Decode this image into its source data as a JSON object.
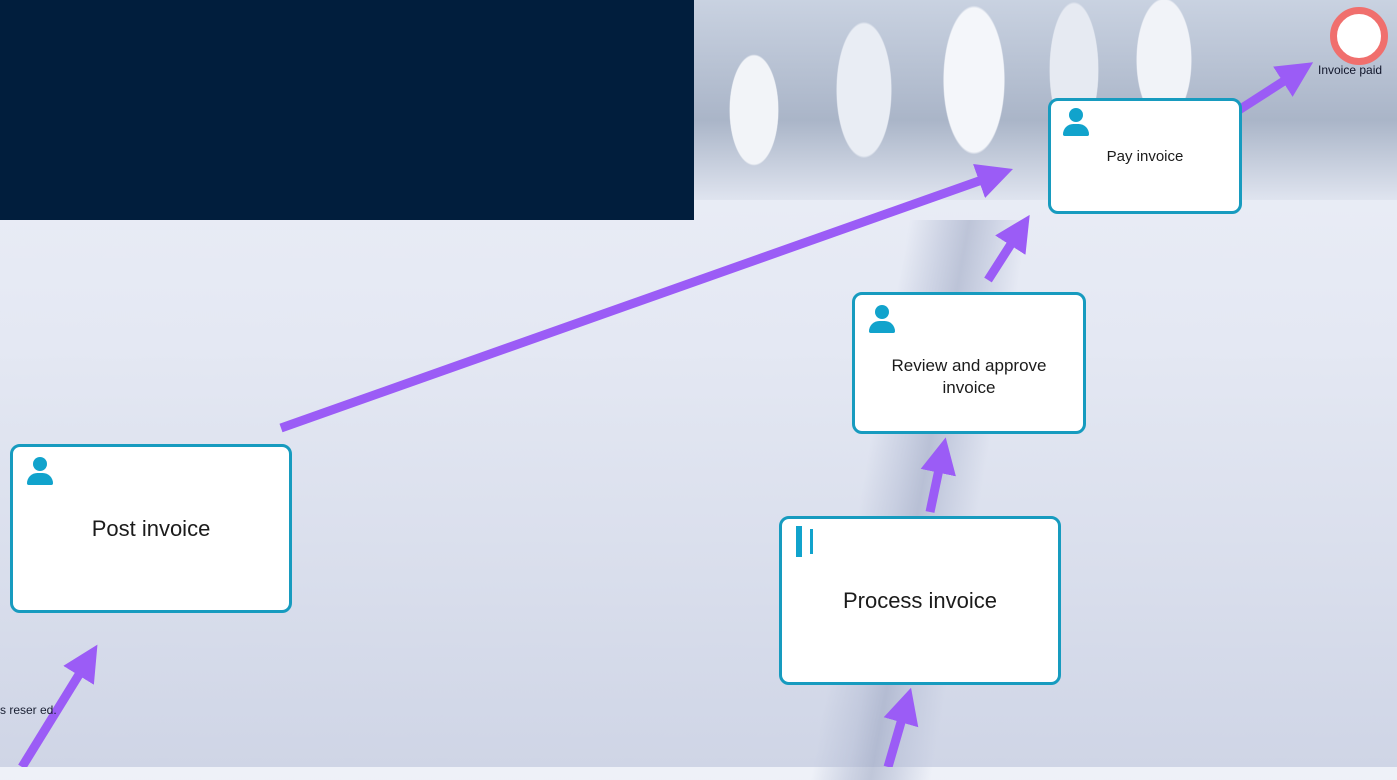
{
  "tasks": {
    "post": "Post invoice",
    "process": "Process invoice",
    "review": "Review and approve invoice",
    "pay": "Pay invoice"
  },
  "end_event": {
    "label": "Invoice paid"
  },
  "footer": {
    "text": "s reser  ed."
  },
  "colors": {
    "task_border": "#179bbf",
    "icon": "#11a3cc",
    "flow_arrow": "#9b5cf6",
    "end_event": "#f06f6d",
    "dark_panel": "#011e3d"
  },
  "icons": {
    "post": "user-icon",
    "process": "table-icon",
    "review": "user-icon",
    "pay": "user-icon"
  }
}
